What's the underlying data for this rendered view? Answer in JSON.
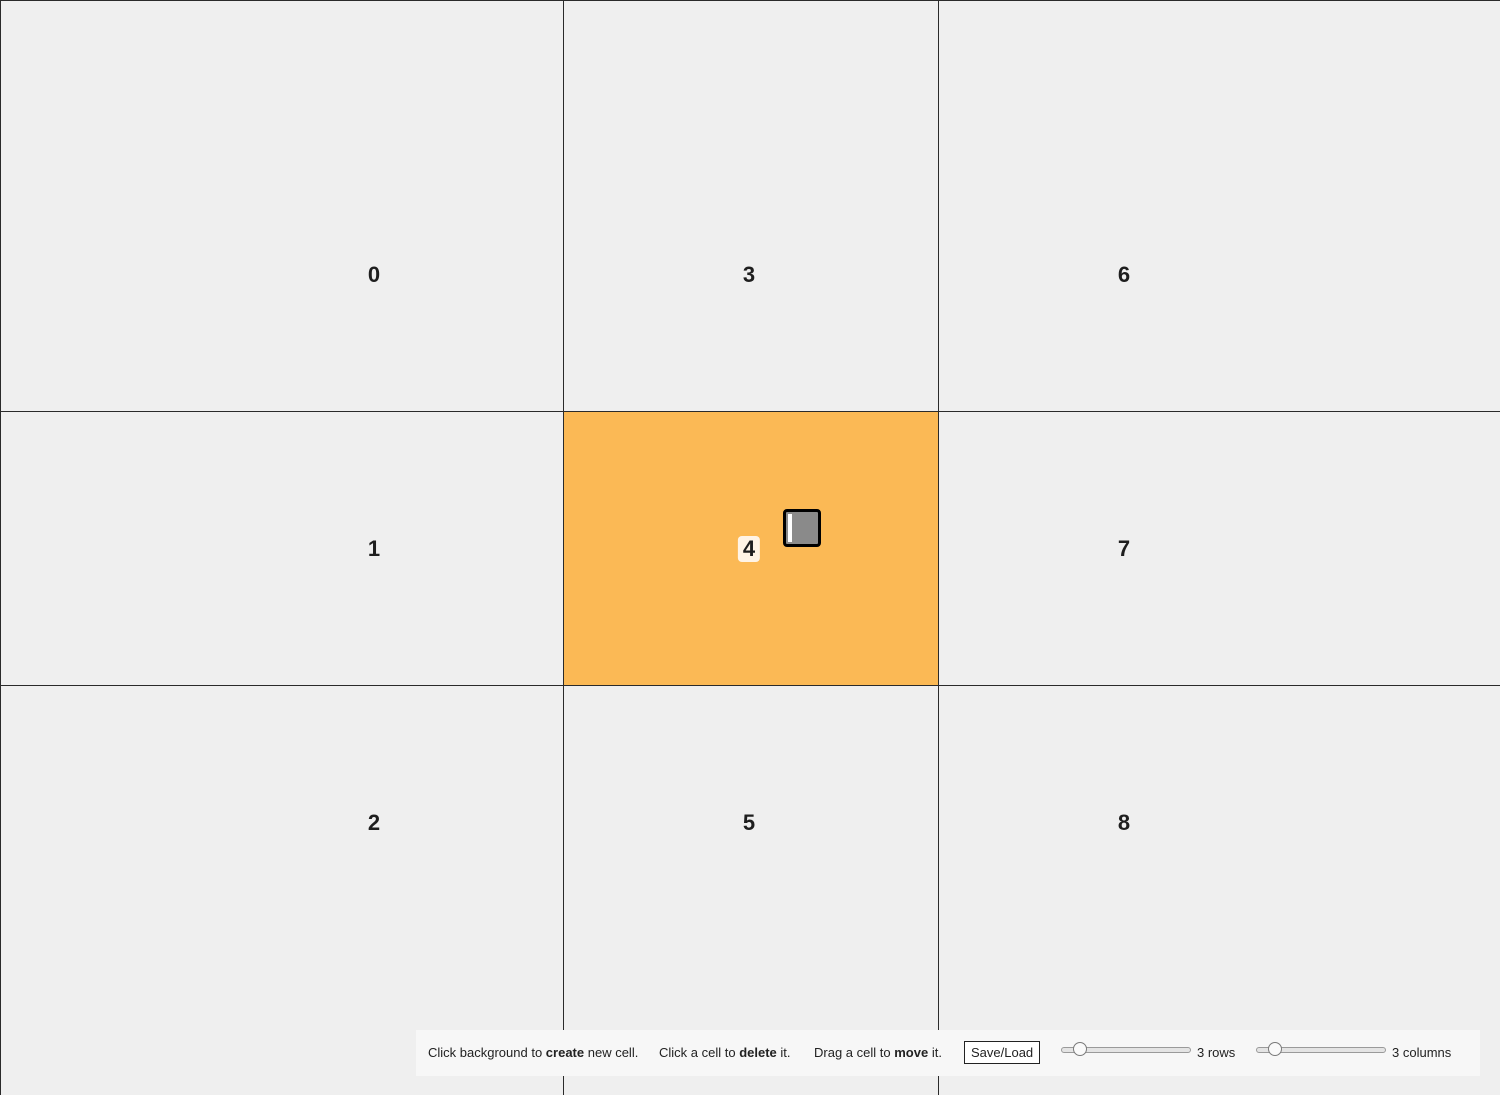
{
  "grid": {
    "selected_cell": "4",
    "selected_color": "#fbb955",
    "background_color": "#efefef",
    "cells": [
      {
        "label": "0"
      },
      {
        "label": "1"
      },
      {
        "label": "2"
      },
      {
        "label": "3"
      },
      {
        "label": "4"
      },
      {
        "label": "5"
      },
      {
        "label": "6"
      },
      {
        "label": "7"
      },
      {
        "label": "8"
      }
    ],
    "handle_icon": "resize-handle-icon"
  },
  "toolbar": {
    "hint_create": {
      "pre": "Click background to",
      "bold": "create",
      "post": "new cell."
    },
    "hint_delete": {
      "pre": "Click a cell to",
      "bold": "delete",
      "post": "it."
    },
    "hint_move": {
      "pre": "Drag a cell to",
      "bold": "move",
      "post": "it."
    },
    "save_load_label": "Save/Load",
    "rows": {
      "value": 3,
      "min": 1,
      "max": 20,
      "label": "3 rows"
    },
    "columns": {
      "value": 3,
      "min": 1,
      "max": 20,
      "label": "3 columns"
    }
  }
}
